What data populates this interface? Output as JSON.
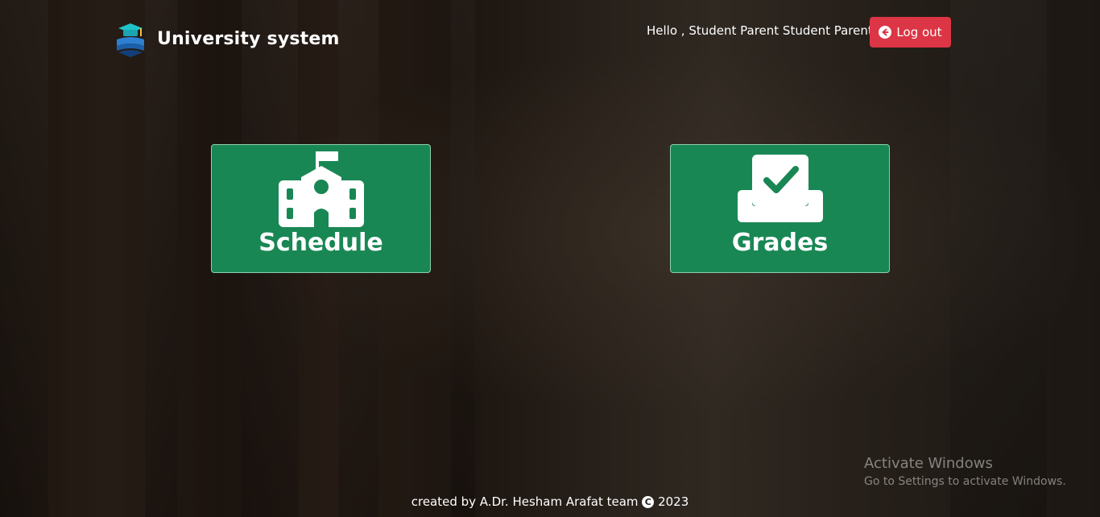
{
  "header": {
    "brand_title": "University system",
    "greeting": "Hello , Student Parent Student Parent",
    "logout_label": "Log out",
    "logout_color": "#dc3545"
  },
  "tiles": [
    {
      "label": "Schedule",
      "icon": "school-icon"
    },
    {
      "label": "Grades",
      "icon": "inbox-check-icon"
    }
  ],
  "footer": {
    "prefix": "created by A.Dr. Hesham Arafat team",
    "copyright_symbol": "C",
    "year": "2023"
  },
  "watermark": {
    "title": "Activate Windows",
    "subtitle": "Go to Settings to activate Windows."
  },
  "colors": {
    "tile_green": "#198754",
    "text": "#ffffff"
  }
}
